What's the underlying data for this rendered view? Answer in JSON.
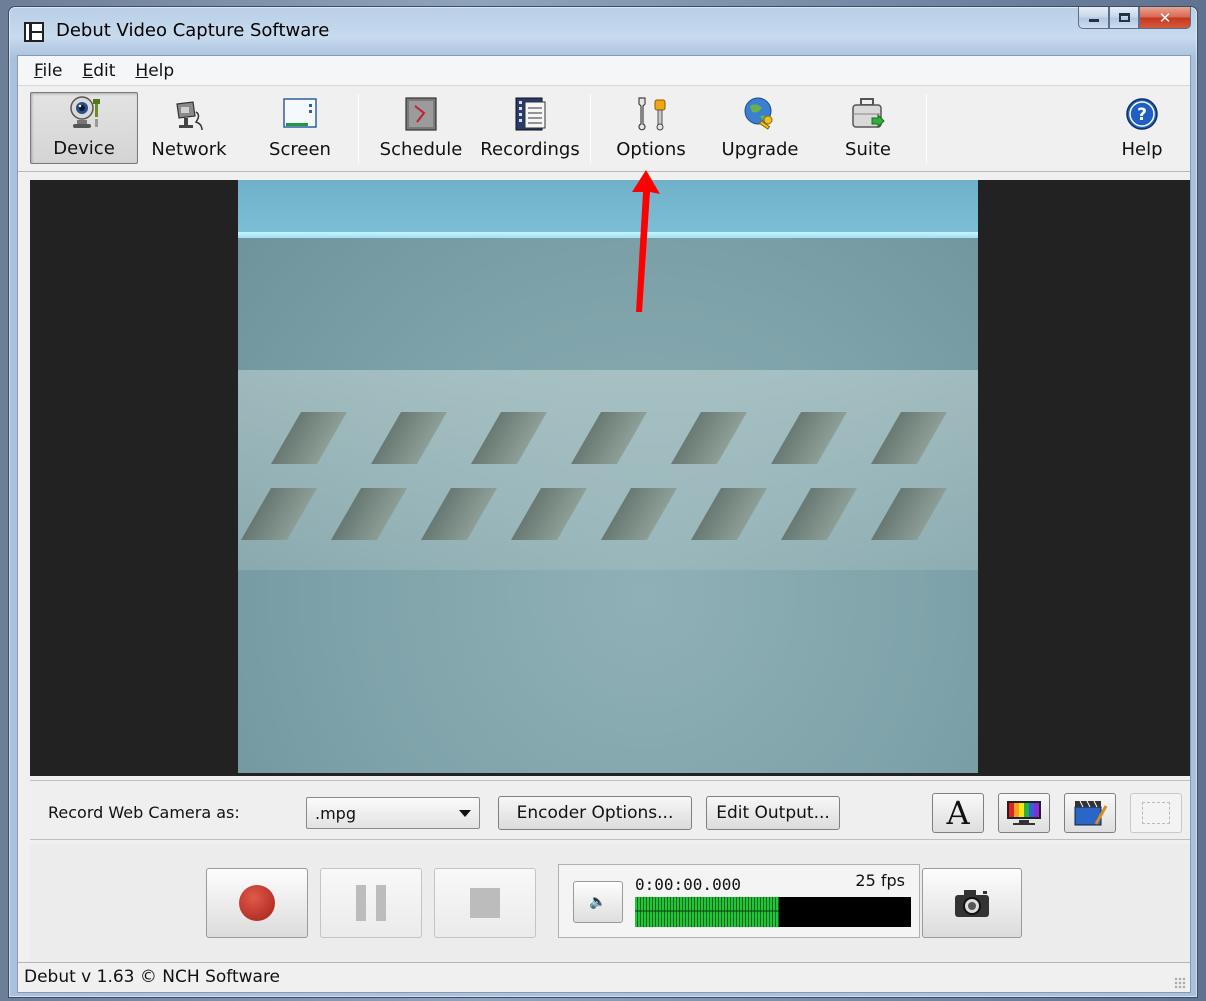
{
  "window": {
    "title": "Debut Video Capture Software"
  },
  "menu": {
    "items": [
      "File",
      "Edit",
      "Help"
    ]
  },
  "toolbar": {
    "buttons": [
      {
        "label": "Device",
        "icon": "webcam-icon",
        "active": true
      },
      {
        "label": "Network",
        "icon": "network-camera-icon"
      },
      {
        "label": "Screen",
        "icon": "screen-icon"
      },
      {
        "label": "Schedule",
        "icon": "schedule-icon"
      },
      {
        "label": "Recordings",
        "icon": "film-recordings-icon"
      },
      {
        "label": "Options",
        "icon": "options-tools-icon"
      },
      {
        "label": "Upgrade",
        "icon": "upgrade-globe-key-icon"
      },
      {
        "label": "Suite",
        "icon": "suite-briefcase-icon"
      },
      {
        "label": "Help",
        "icon": "help-question-icon"
      }
    ]
  },
  "record": {
    "label": "Record Web Camera as:",
    "format_selected": ".mpg",
    "encoder_options_label": "Encoder Options...",
    "edit_output_label": "Edit Output...",
    "icon_buttons": [
      "text-overlay-icon",
      "color-adjust-icon",
      "video-effects-icon",
      "crop-selection-icon"
    ]
  },
  "transport": {
    "time": "0:00:00.000",
    "fps": "25 fps",
    "level_fraction": 0.52,
    "buttons": [
      "record-icon",
      "pause-icon",
      "stop-icon",
      "volume-icon",
      "snapshot-camera-icon"
    ]
  },
  "status": {
    "text": "Debut v 1.63 © NCH Software"
  },
  "colors": {
    "accent_record": "#c0392b",
    "meter_green": "#22c53a",
    "annotation_red": "#ff0000"
  }
}
